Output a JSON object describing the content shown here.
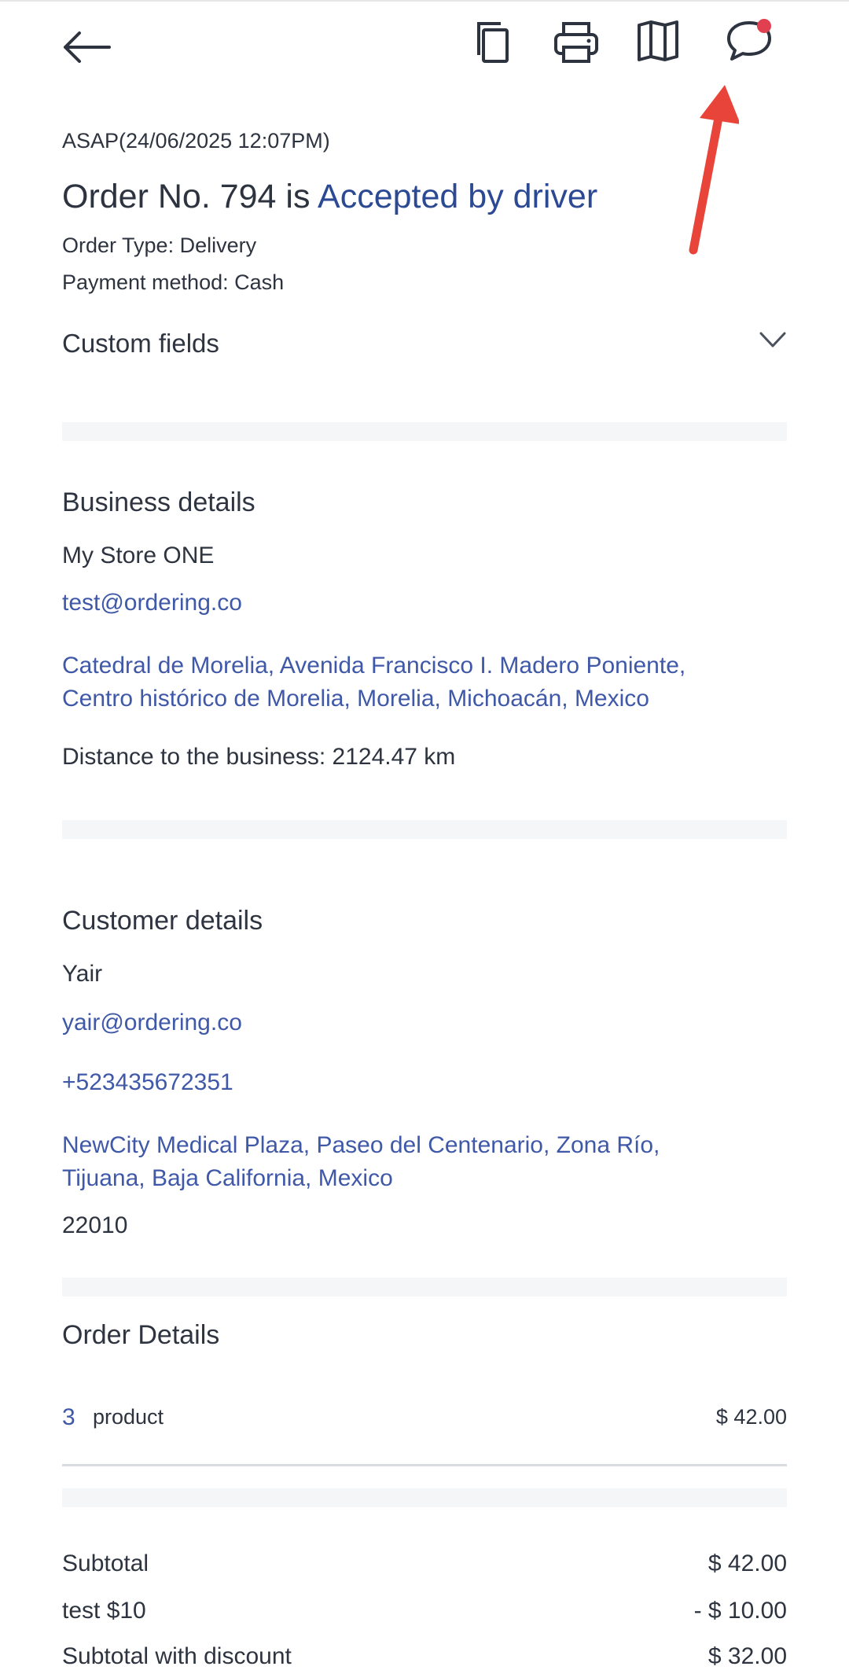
{
  "header": {
    "back_icon": "arrow-left-icon",
    "actions": [
      "copy-icon",
      "print-icon",
      "map-icon",
      "chat-icon"
    ],
    "chat_badge_color": "#e0404f"
  },
  "order": {
    "schedule": "ASAP(24/06/2025 12:07PM)",
    "title_prefix": "Order No. 794 is ",
    "status": "Accepted by driver",
    "status_color": "#2c4a93",
    "order_type": "Order Type: Delivery",
    "payment_method": "Payment method: Cash",
    "custom_fields_label": "Custom fields"
  },
  "business": {
    "heading": "Business details",
    "name": "My Store ONE",
    "email": "test@ordering.co",
    "address_line1": "Catedral de Morelia, Avenida Francisco I. Madero Poniente,",
    "address_line2": "Centro histórico de Morelia, Morelia, Michoacán, Mexico",
    "distance": "Distance to the business: 2124.47 km"
  },
  "customer": {
    "heading": "Customer details",
    "name": "Yair",
    "email": "yair@ordering.co",
    "phone": "+523435672351",
    "address_line1": "NewCity Medical Plaza, Paseo del Centenario, Zona Río,",
    "address_line2": "Tijuana, Baja California, Mexico",
    "zipcode": "22010"
  },
  "order_details": {
    "heading": "Order Details",
    "items": [
      {
        "quantity": "3",
        "name": "product",
        "price": "$ 42.00"
      }
    ]
  },
  "totals": {
    "subtotal_label": "Subtotal",
    "subtotal_value": "$ 42.00",
    "discount_label": "test $10",
    "discount_value": "- $ 10.00",
    "subtotal_discount_label": "Subtotal with discount",
    "subtotal_discount_value": "$ 32.00"
  },
  "annotation": {
    "arrow_color": "#e8443a"
  }
}
